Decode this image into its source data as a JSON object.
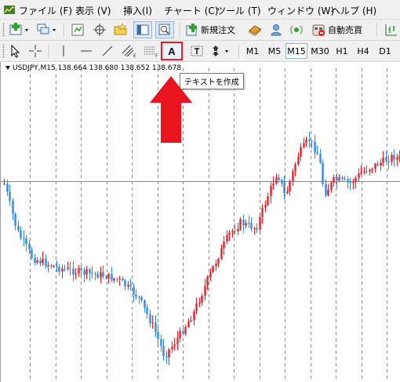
{
  "menu": {
    "items": [
      {
        "label": "ファイル (F)"
      },
      {
        "label": "表示 (V)"
      },
      {
        "label": "挿入(I)"
      },
      {
        "label": "チャート (C)"
      },
      {
        "label": "ツール (T)"
      },
      {
        "label": "ウィンドウ (W)"
      },
      {
        "label": "ヘルプ (H)"
      }
    ]
  },
  "toolbar1": {
    "new_order_label": "新規注文",
    "auto_trading_label": "自動売買"
  },
  "toolbar2": {
    "text_tool_label": "A",
    "text_label_tool_label": "T",
    "periods": [
      "M1",
      "M5",
      "M15",
      "M30",
      "H1",
      "H4",
      "D1"
    ],
    "active_period": "M15"
  },
  "chart": {
    "symbol_label": "USDJPY,M15",
    "ohlc": [
      "138.664",
      "138.680",
      "138.652",
      "138.678"
    ],
    "tooltip": "テキストを作成",
    "colors": {
      "up": "#e8202a",
      "down": "#2f8ae8",
      "grid": "#8a8a8a",
      "current_price_line": "#6f8aa8",
      "highlight": "#e0202a"
    }
  },
  "chart_data": {
    "type": "candlestick",
    "symbol": "USDJPY",
    "timeframe": "M15",
    "open": 138.664,
    "high": 138.68,
    "low": 138.652,
    "close": 138.678
  }
}
